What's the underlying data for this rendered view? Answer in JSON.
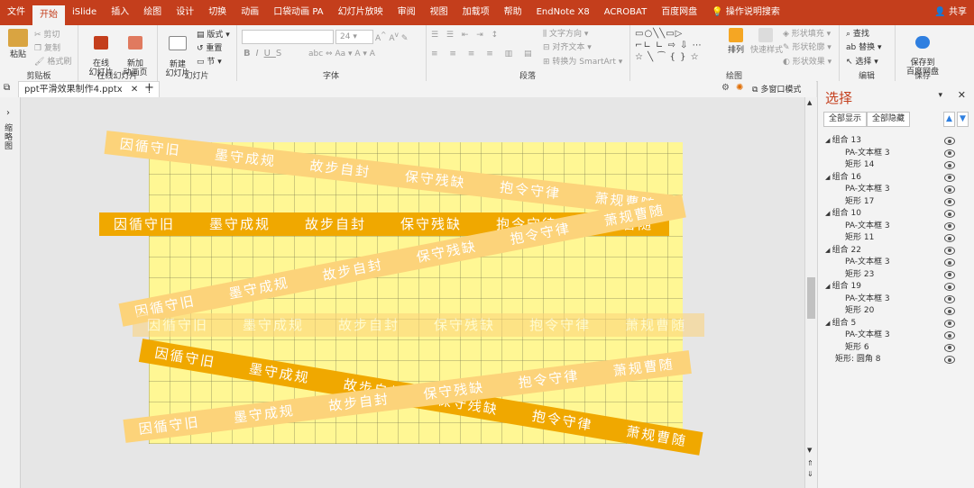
{
  "tabs": [
    "文件",
    "开始",
    "iSlide",
    "插入",
    "绘图",
    "设计",
    "切换",
    "动画",
    "口袋动画 PA",
    "幻灯片放映",
    "审阅",
    "视图",
    "加载项",
    "帮助",
    "EndNote X8",
    "ACROBAT",
    "百度网盘"
  ],
  "active_tab": "开始",
  "tell_me": "操作说明搜索",
  "share": "共享",
  "ribbon": {
    "clipboard": {
      "paste": "粘贴",
      "cut": "剪切",
      "copy": "复制",
      "format_painter": "格式刷",
      "label": "剪贴板"
    },
    "online": {
      "online_slides": "在线\n幻灯片",
      "new_anim": "新加\n动画页",
      "label": "在线幻灯片"
    },
    "slides": {
      "new_slide": "新建\n幻灯片",
      "layout": "版式",
      "reset": "重置",
      "section": "节",
      "label": "幻灯片"
    },
    "font": {
      "size": "24",
      "label": "字体"
    },
    "paragraph": {
      "text_direction": "文字方向",
      "align_text": "对齐文本",
      "smartart": "转换为 SmartArt",
      "label": "段落"
    },
    "drawing": {
      "arrange": "排列",
      "quick_styles": "快速样式",
      "shape_fill": "形状填充",
      "shape_outline": "形状轮廓",
      "shape_effects": "形状效果",
      "label": "绘图"
    },
    "editing": {
      "find": "查找",
      "replace": "替换",
      "select": "选择",
      "label": "编辑"
    },
    "save": {
      "save_baidu": "保存到\n百度网盘",
      "label": "保存"
    }
  },
  "doc_tab": "ppt平滑效果制作4.pptx",
  "left_strip_label": "缩略图",
  "canvas_toolbar": {
    "multi_window": "多窗口模式"
  },
  "strip_text": [
    "因循守旧",
    "墨守成规",
    "故步自封",
    "保守残缺",
    "抱令守律",
    "萧规曹随"
  ],
  "selection_pane": {
    "title": "选择",
    "show_all": "全部显示",
    "hide_all": "全部隐藏",
    "items": [
      {
        "label": "组合 13",
        "level": 0
      },
      {
        "label": "PA-文本框 3",
        "level": 1
      },
      {
        "label": "矩形 14",
        "level": 1
      },
      {
        "label": "组合 16",
        "level": 0
      },
      {
        "label": "PA-文本框 3",
        "level": 1
      },
      {
        "label": "矩形 17",
        "level": 1
      },
      {
        "label": "组合 10",
        "level": 0
      },
      {
        "label": "PA-文本框 3",
        "level": 1
      },
      {
        "label": "矩形 11",
        "level": 1
      },
      {
        "label": "组合 22",
        "level": 0
      },
      {
        "label": "PA-文本框 3",
        "level": 1
      },
      {
        "label": "矩形 23",
        "level": 1
      },
      {
        "label": "组合 19",
        "level": 0
      },
      {
        "label": "PA-文本框 3",
        "level": 1
      },
      {
        "label": "矩形 20",
        "level": 1
      },
      {
        "label": "组合 5",
        "level": 0
      },
      {
        "label": "PA-文本框 3",
        "level": 1
      },
      {
        "label": "矩形 6",
        "level": 1
      },
      {
        "label": "矩形: 圆角 8",
        "level": 0
      }
    ]
  },
  "colors": {
    "accent": "#c43e1c",
    "strip_dark": "#f0a800",
    "strip_mid": "#f9bd26",
    "strip_light": "#fcd37a",
    "slide_bg": "#fff794"
  }
}
